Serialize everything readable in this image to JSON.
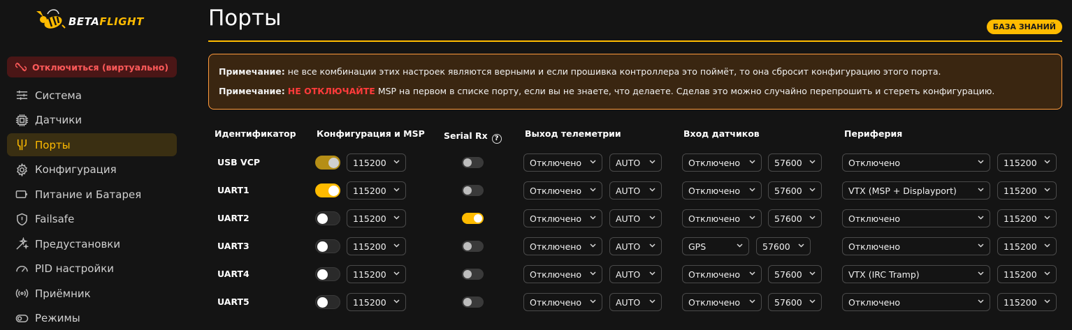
{
  "app": {
    "logo_prefix": "BETA",
    "logo_suffix": "FLIGHT",
    "accent": "#ffbb00"
  },
  "sidebar": {
    "disconnect_label": "Отключиться (виртуально)",
    "items": [
      {
        "label": "Система",
        "icon": "sliders-icon"
      },
      {
        "label": "Датчики",
        "icon": "chip-icon"
      },
      {
        "label": "Порты",
        "icon": "ports-icon",
        "active": true
      },
      {
        "label": "Конфигурация",
        "icon": "gear-icon"
      },
      {
        "label": "Питание и Батарея",
        "icon": "battery-icon"
      },
      {
        "label": "Failsafe",
        "icon": "shield-icon"
      },
      {
        "label": "Предустановки",
        "icon": "wand-icon"
      },
      {
        "label": "PID настройки",
        "icon": "gauge-icon"
      },
      {
        "label": "Приёмник",
        "icon": "signal-icon"
      },
      {
        "label": "Режимы",
        "icon": "toggle-icon"
      }
    ]
  },
  "page": {
    "title": "Порты",
    "knowledge_button": "БАЗА ЗНАНИЙ",
    "note1_label": "Примечание:",
    "note1_text": " не все комбинации этих настроек являются верными и если прошивка контроллера это поймёт, то она сбросит конфигурацию этого порта.",
    "note2_label": "Примечание:",
    "note2_danger": "НЕ ОТКЛЮЧАЙТЕ",
    "note2_text": " MSP на первом в списке порту, если вы не знаете, что делаете. Сделав это можно случайно перепрошить и стереть конфигурацию."
  },
  "table": {
    "headers": {
      "id": "Идентификатор",
      "msp": "Конфигурация и MSP",
      "serial_rx": "Serial Rx",
      "telemetry": "Выход телеметрии",
      "sensors": "Вход датчиков",
      "peripherals": "Периферия"
    },
    "rows": [
      {
        "id": "USB VCP",
        "msp_on": true,
        "msp_dim": true,
        "msp_baud": "115200",
        "serial_rx": false,
        "telemetry": "Отключено",
        "telemetry_baud": "AUTO",
        "sensor": "Отключено",
        "sensor_baud": "57600",
        "peripheral": "Отключено",
        "peripheral_baud": "115200"
      },
      {
        "id": "UART1",
        "msp_on": true,
        "msp_dim": false,
        "msp_baud": "115200",
        "serial_rx": false,
        "telemetry": "Отключено",
        "telemetry_baud": "AUTO",
        "sensor": "Отключено",
        "sensor_baud": "57600",
        "peripheral": "VTX (MSP + Displayport)",
        "peripheral_baud": "115200"
      },
      {
        "id": "UART2",
        "msp_on": false,
        "msp_dim": false,
        "msp_baud": "115200",
        "serial_rx": true,
        "telemetry": "Отключено",
        "telemetry_baud": "AUTO",
        "sensor": "Отключено",
        "sensor_baud": "57600",
        "peripheral": "Отключено",
        "peripheral_baud": "115200"
      },
      {
        "id": "UART3",
        "msp_on": false,
        "msp_dim": false,
        "msp_baud": "115200",
        "serial_rx": false,
        "telemetry": "Отключено",
        "telemetry_baud": "AUTO",
        "sensor": "GPS",
        "sensor_baud": "57600",
        "peripheral": "Отключено",
        "peripheral_baud": "115200"
      },
      {
        "id": "UART4",
        "msp_on": false,
        "msp_dim": false,
        "msp_baud": "115200",
        "serial_rx": false,
        "telemetry": "Отключено",
        "telemetry_baud": "AUTO",
        "sensor": "Отключено",
        "sensor_baud": "57600",
        "peripheral": "VTX (IRC Tramp)",
        "peripheral_baud": "115200"
      },
      {
        "id": "UART5",
        "msp_on": false,
        "msp_dim": false,
        "msp_baud": "115200",
        "serial_rx": false,
        "telemetry": "Отключено",
        "telemetry_baud": "AUTO",
        "sensor": "Отключено",
        "sensor_baud": "57600",
        "peripheral": "Отключено",
        "peripheral_baud": "115200"
      }
    ]
  }
}
